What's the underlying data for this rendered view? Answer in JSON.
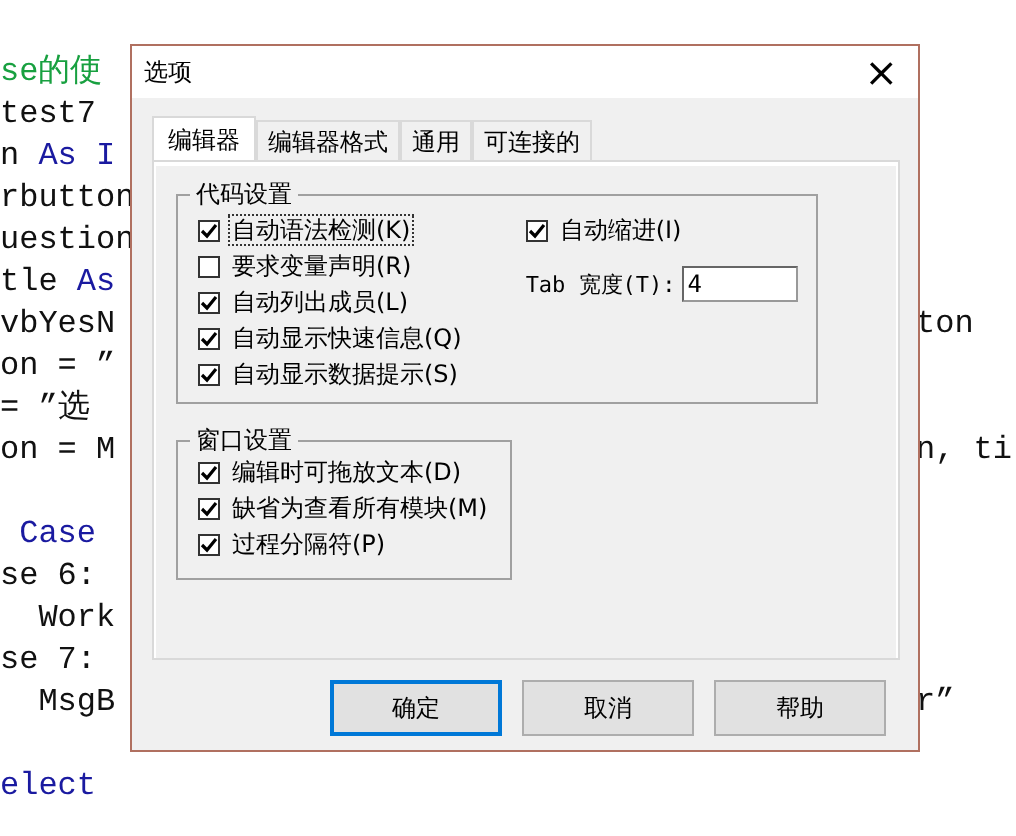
{
  "code_lines": [
    {
      "left": [
        {
          "text": "se的使",
          "kind": "comment"
        }
      ]
    },
    {
      "left": [
        {
          "text": "test7",
          "kind": "plain"
        }
      ]
    },
    {
      "left": [
        {
          "text": "n ",
          "kind": "plain"
        },
        {
          "text": "As I",
          "kind": "keyword"
        }
      ]
    },
    {
      "left": [
        {
          "text": "rbutton",
          "kind": "plain"
        }
      ]
    },
    {
      "left": [
        {
          "text": "uestion",
          "kind": "plain"
        }
      ]
    },
    {
      "left": [
        {
          "text": "tle ",
          "kind": "plain"
        },
        {
          "text": "As",
          "kind": "keyword"
        }
      ]
    },
    {
      "left": [
        {
          "text": "vbYesN",
          "kind": "plain"
        }
      ],
      "right": [
        {
          "text": "ton",
          "kind": "plain"
        }
      ]
    },
    {
      "left": [
        {
          "text": "on = ”",
          "kind": "plain"
        }
      ]
    },
    {
      "left": [
        {
          "text": "= ”选",
          "kind": "plain"
        }
      ]
    },
    {
      "left": [
        {
          "text": "on = M",
          "kind": "plain"
        }
      ],
      "right": [
        {
          "text": "n, ti",
          "kind": "plain"
        }
      ]
    },
    {
      "blank_before": true,
      "left": [
        {
          "text": " Case",
          "kind": "keyword"
        }
      ]
    },
    {
      "left": [
        {
          "text": "se 6:",
          "kind": "plain"
        }
      ]
    },
    {
      "left": [
        {
          "text": "  Work",
          "kind": "plain"
        }
      ]
    },
    {
      "left": [
        {
          "text": "se 7:",
          "kind": "plain"
        }
      ]
    },
    {
      "left": [
        {
          "text": "  MsgB",
          "kind": "plain"
        }
      ],
      "right": [
        {
          "text": "r”",
          "kind": "plain"
        }
      ]
    },
    {
      "blank_before": true,
      "left": [
        {
          "text": "elect",
          "kind": "keyword"
        }
      ]
    }
  ],
  "dialog": {
    "title": "选项",
    "close": "×",
    "tabs": [
      {
        "label": "编辑器",
        "selected": true
      },
      {
        "label": "编辑器格式",
        "selected": false
      },
      {
        "label": "通用",
        "selected": false
      },
      {
        "label": "可连接的",
        "selected": false
      }
    ],
    "code_settings": {
      "title": "代码设置",
      "options": [
        {
          "label": "自动语法检测(K)",
          "checked": true,
          "focused": true
        },
        {
          "label": "要求变量声明(R)",
          "checked": false,
          "focused": false
        },
        {
          "label": "自动列出成员(L)",
          "checked": true,
          "focused": false
        },
        {
          "label": "自动显示快速信息(Q)",
          "checked": true,
          "focused": false
        },
        {
          "label": "自动显示数据提示(S)",
          "checked": true,
          "focused": false
        }
      ],
      "auto_indent": {
        "label": "自动缩进(I)",
        "checked": true
      },
      "tab_width": {
        "label": "Tab 宽度(T):",
        "value": "4"
      }
    },
    "window_settings": {
      "title": "窗口设置",
      "options": [
        {
          "label": "编辑时可拖放文本(D)",
          "checked": true,
          "focused": false
        },
        {
          "label": "缺省为查看所有模块(M)",
          "checked": true,
          "focused": false
        },
        {
          "label": "过程分隔符(P)",
          "checked": true,
          "focused": false
        }
      ]
    },
    "buttons": [
      {
        "label": "确定",
        "default": true
      },
      {
        "label": "取消",
        "default": false
      },
      {
        "label": "帮助",
        "default": false
      }
    ]
  }
}
